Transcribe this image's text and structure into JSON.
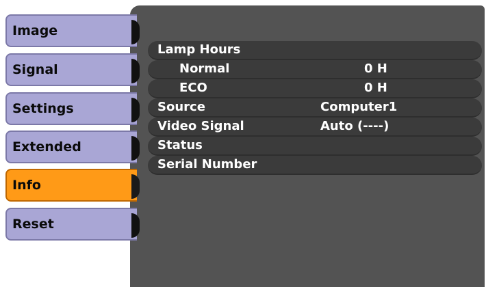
{
  "menu": {
    "items": [
      {
        "label": "Image",
        "selected": false
      },
      {
        "label": "Signal",
        "selected": false
      },
      {
        "label": "Settings",
        "selected": false
      },
      {
        "label": "Extended",
        "selected": false
      },
      {
        "label": "Info",
        "selected": true
      },
      {
        "label": "Reset",
        "selected": false
      }
    ]
  },
  "info": {
    "lamp_hours_label": "Lamp Hours",
    "normal_label": "Normal",
    "normal_value": "0 H",
    "eco_label": "ECO",
    "eco_value": "0 H",
    "source_label": "Source",
    "source_value": "Computer1",
    "video_signal_label": "Video Signal",
    "video_signal_value": "Auto (----)",
    "status_label": "Status",
    "serial_number_label": "Serial Number"
  },
  "colors": {
    "panel": "#535353",
    "tab": "#a9a6d5",
    "tab_selected": "#ff9a17"
  }
}
